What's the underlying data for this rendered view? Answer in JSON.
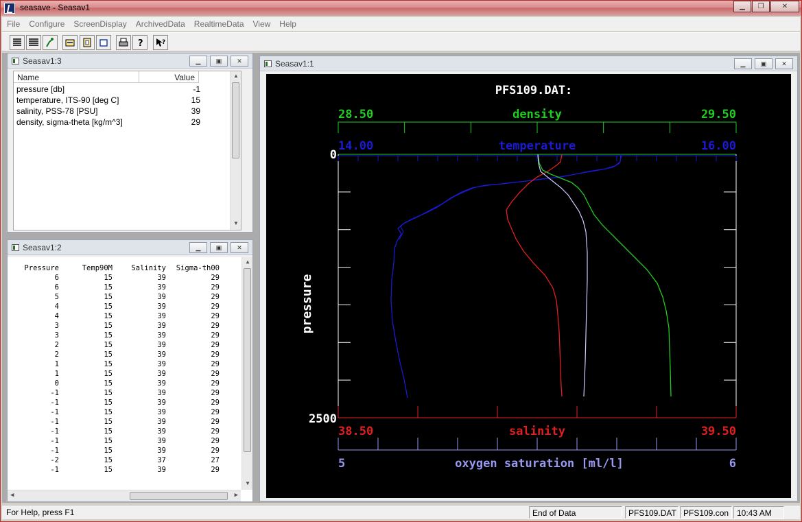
{
  "app": {
    "title": "seasave - Seasav1"
  },
  "menu": [
    "File",
    "Configure",
    "ScreenDisplay",
    "ArchivedData",
    "RealtimeData",
    "View",
    "Help"
  ],
  "toolbar": {
    "icons": [
      "list-report-icon",
      "table-report-icon",
      "run-icon",
      "new-display-icon",
      "new-document-icon",
      "new-window-icon",
      "print-icon",
      "about-icon",
      "context-help-icon"
    ]
  },
  "win3": {
    "title": "Seasav1:3",
    "columns": [
      "Name",
      "Value"
    ],
    "rows": [
      {
        "name": "pressure [db]",
        "value": "-1"
      },
      {
        "name": "temperature, ITS-90 [deg C]",
        "value": "15"
      },
      {
        "name": "salinity, PSS-78 [PSU]",
        "value": "39"
      },
      {
        "name": "density, sigma-theta [kg/m^3]",
        "value": "29"
      }
    ]
  },
  "win2": {
    "title": "Seasav1:2",
    "columns": [
      "Pressure",
      "Temp90M",
      "Salinity",
      "Sigma-th00"
    ],
    "rows": [
      [
        "6",
        "15",
        "39",
        "29"
      ],
      [
        "6",
        "15",
        "39",
        "29"
      ],
      [
        "5",
        "15",
        "39",
        "29"
      ],
      [
        "4",
        "15",
        "39",
        "29"
      ],
      [
        "4",
        "15",
        "39",
        "29"
      ],
      [
        "3",
        "15",
        "39",
        "29"
      ],
      [
        "3",
        "15",
        "39",
        "29"
      ],
      [
        "2",
        "15",
        "39",
        "29"
      ],
      [
        "2",
        "15",
        "39",
        "29"
      ],
      [
        "1",
        "15",
        "39",
        "29"
      ],
      [
        "1",
        "15",
        "39",
        "29"
      ],
      [
        "0",
        "15",
        "39",
        "29"
      ],
      [
        "-1",
        "15",
        "39",
        "29"
      ],
      [
        "-1",
        "15",
        "39",
        "29"
      ],
      [
        "-1",
        "15",
        "39",
        "29"
      ],
      [
        "-1",
        "15",
        "39",
        "29"
      ],
      [
        "-1",
        "15",
        "39",
        "29"
      ],
      [
        "-1",
        "15",
        "39",
        "29"
      ],
      [
        "-1",
        "15",
        "39",
        "29"
      ],
      [
        "-2",
        "15",
        "37",
        "27"
      ],
      [
        "-1",
        "15",
        "39",
        "29"
      ]
    ]
  },
  "win1": {
    "title": "Seasav1:1",
    "plot_title": "PFS109.DAT:",
    "y_label": "pressure",
    "y_top": "0",
    "y_bottom": "2500",
    "axes": {
      "density": {
        "name": "density",
        "min": "28.50",
        "max": "29.50",
        "color": "#22cc22"
      },
      "temperature": {
        "name": "temperature",
        "min": "14.00",
        "max": "16.00",
        "color": "#1a1ad0"
      },
      "salinity": {
        "name": "salinity",
        "min": "38.50",
        "max": "39.50",
        "color": "#e02020"
      },
      "oxygen": {
        "name": "oxygen saturation [ml/l]",
        "min": "5",
        "max": "6",
        "color": "#9999f0"
      }
    }
  },
  "status": {
    "help": "For Help, press F1",
    "state": "End of Data",
    "data_file": "PFS109.DAT",
    "con_file": "PFS109.con",
    "time": "10:43 AM"
  }
}
